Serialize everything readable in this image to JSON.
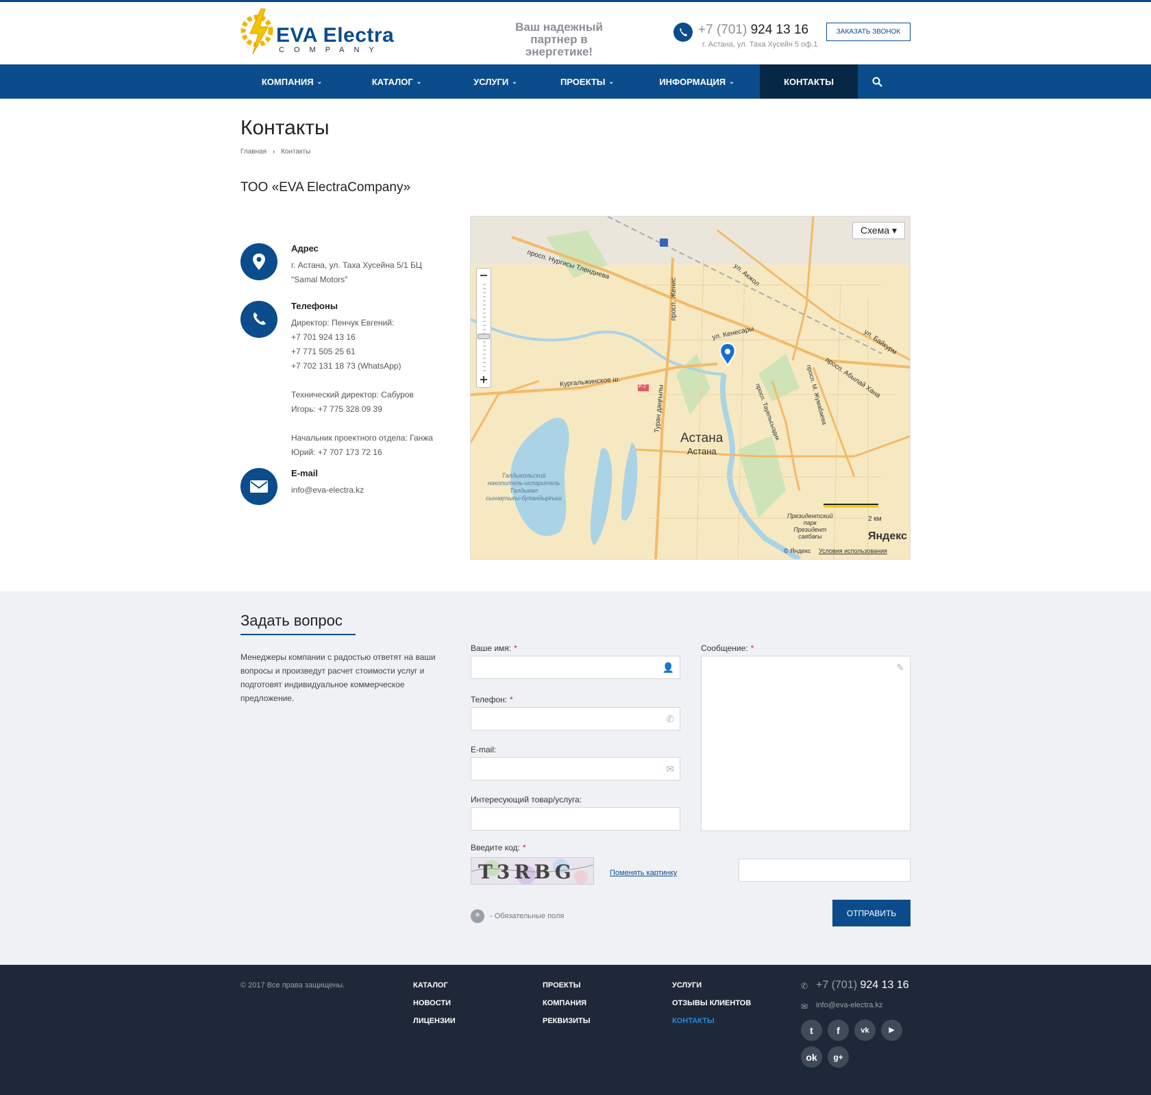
{
  "header": {
    "logo_text": "EVA Electra",
    "logo_sub": "COMPANY",
    "slogan": "Ваш надежный партнер в энергетике!",
    "phone_prefix": "+7 (701)",
    "phone_number": "924 13 16",
    "address": "г. Астана, ул. Таха Хусейн 5 оф.1",
    "callback_label": "Заказать звонок",
    "accent_color": "#0b4c8c"
  },
  "nav": {
    "items": [
      {
        "label": "Компания",
        "has_dropdown": true
      },
      {
        "label": "Каталог",
        "has_dropdown": true
      },
      {
        "label": "Услуги",
        "has_dropdown": true
      },
      {
        "label": "Проекты",
        "has_dropdown": true
      },
      {
        "label": "Информация",
        "has_dropdown": true
      },
      {
        "label": "Контакты",
        "has_dropdown": false,
        "active": true
      }
    ],
    "search_icon": "search-icon"
  },
  "page": {
    "title": "Контакты",
    "breadcrumbs": [
      "Главная",
      "Контакты"
    ],
    "company": "ТОО «EVA ElectraCompany»"
  },
  "contacts": {
    "address": {
      "title": "Адрес",
      "lines": [
        "г. Астана, ул. Таха Хусейна 5/1 БЦ",
        "\"Samal Motors\""
      ]
    },
    "phones": {
      "title": "Телефоны",
      "lines": [
        "Директор: Пенчук Евгений:",
        "+7 701 924 13 16",
        "+7 771 505 25 61",
        "+7 702 131 18 73 (WhatsApp)",
        "",
        "Технический директор: Сабуров",
        "Игорь: +7 775 328 09 39",
        "",
        "Начальник проектного отдела: Ганжа",
        "Юрий: +7 707 173 72 16"
      ]
    },
    "email": {
      "title": "E-mail",
      "value": "info@eva-electra.kz"
    }
  },
  "map": {
    "type_selector": "Схема ▾",
    "city_label": "Астана",
    "city_label_sub": "Астана",
    "streets": [
      "просп. Нургисы Тлендиева",
      "ул. Кенесары",
      "просп. Женис",
      "ул. Акжол",
      "ул. Байкурм",
      "просп. Абылай Хана",
      "просп. М. Жумабаева",
      "просп. Тауельсыздик",
      "Кургальжинское ш.",
      "Туран даңғылы"
    ],
    "reservoir": [
      "Талдыкольский",
      "накопитель-испаритель",
      "Талдыкөл",
      "сынақтығы-буландырғыш"
    ],
    "park": [
      "Президентский",
      "парк",
      "Президент",
      "саябағы"
    ],
    "road_badge": "Р-2",
    "scale": "2 км",
    "brand": "Яндекс",
    "copyright": "© Яндекс",
    "terms": "Условия использования"
  },
  "form": {
    "title": "Задать вопрос",
    "description": "Менеджеры компании с радостью ответят на ваши вопросы и произведут расчет стоимости услуг и подготовят индивидуальное коммерческое предложение.",
    "name_label": "Ваше имя:",
    "phone_label": "Телефон:",
    "email_label": "E-mail:",
    "product_label": "Интересующий товар/услуга:",
    "message_label": "Сообщение:",
    "captcha_label": "Введите код:",
    "captcha_text": "T3RBG",
    "change_captcha": "Поменять картинку",
    "required_note": "- Обязательные поля",
    "submit": "Отправить"
  },
  "footer": {
    "copyright": "© 2017 Все права защищены.",
    "col1": [
      "Каталог",
      "Новости",
      "Лицензии"
    ],
    "col2": [
      "Проекты",
      "Компания",
      "Реквизиты"
    ],
    "col3": [
      "Услуги",
      "Отзывы клиентов",
      "Контакты"
    ],
    "phone_prefix": "+7 (701)",
    "phone_number": "924 13 16",
    "email": "info@eva-electra.kz",
    "social": [
      "twitter-icon",
      "facebook-icon",
      "vk-icon",
      "youtube-icon",
      "odnoklassniki-icon",
      "google-plus-icon"
    ],
    "active_link_color": "#2a8ad8"
  }
}
